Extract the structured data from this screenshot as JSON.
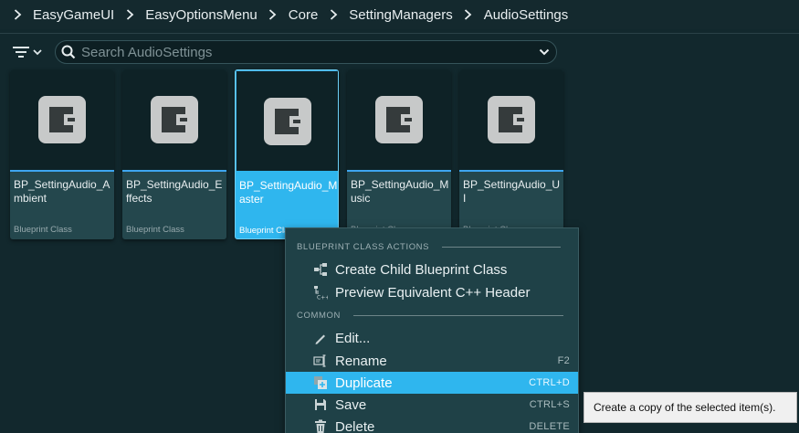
{
  "breadcrumb": {
    "items": [
      "EasyGameUI",
      "EasyOptionsMenu",
      "Core",
      "SettingManagers",
      "AudioSettings"
    ]
  },
  "toolbar": {
    "search_placeholder": "Search AudioSettings"
  },
  "assets": [
    {
      "name": "BP_SettingAudio_Ambient",
      "type": "Blueprint Class",
      "selected": false
    },
    {
      "name": "BP_SettingAudio_Effects",
      "type": "Blueprint Class",
      "selected": false
    },
    {
      "name": "BP_SettingAudio_Master",
      "type": "Blueprint Class",
      "selected": true
    },
    {
      "name": "BP_SettingAudio_Music",
      "type": "Blueprint Class",
      "selected": false
    },
    {
      "name": "BP_SettingAudio_UI",
      "type": "Blueprint Class",
      "selected": false
    }
  ],
  "context_menu": {
    "sections": [
      {
        "title": "BLUEPRINT CLASS ACTIONS",
        "items": [
          {
            "label": "Create Child Blueprint Class",
            "shortcut": "",
            "icon": "child-blueprint-icon"
          },
          {
            "label": "Preview Equivalent C++ Header",
            "shortcut": "",
            "icon": "cpp-header-icon"
          }
        ]
      },
      {
        "title": "COMMON",
        "items": [
          {
            "label": "Edit...",
            "shortcut": "",
            "icon": "edit-pencil-icon"
          },
          {
            "label": "Rename",
            "shortcut": "F2",
            "icon": "rename-icon"
          },
          {
            "label": "Duplicate",
            "shortcut": "CTRL+D",
            "icon": "duplicate-icon",
            "highlighted": true
          },
          {
            "label": "Save",
            "shortcut": "CTRL+S",
            "icon": "save-icon"
          },
          {
            "label": "Delete",
            "shortcut": "DELETE",
            "icon": "trash-icon"
          }
        ]
      }
    ]
  },
  "tooltip": {
    "text": "Create a copy of the selected item(s)."
  },
  "colors": {
    "background": "#12282d",
    "accent": "#2fb6ee",
    "menu_bg": "#1f4147",
    "tile_bg": "#24474d"
  }
}
